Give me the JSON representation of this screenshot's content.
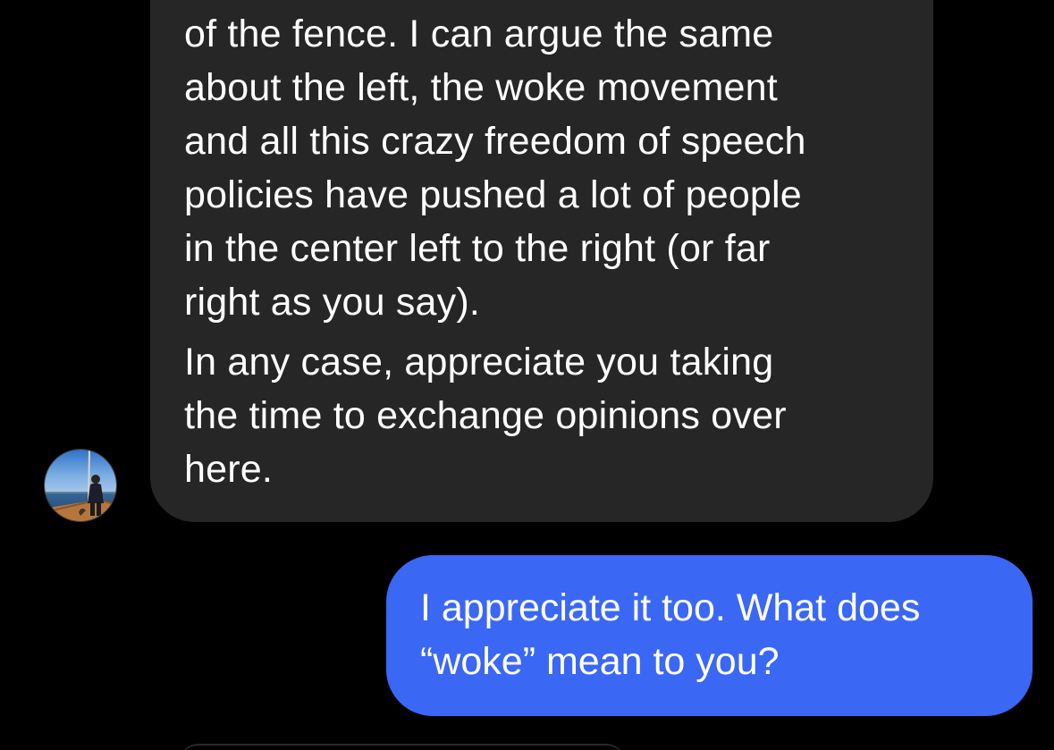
{
  "conversation": {
    "incoming": {
      "lines": [
        "of the fence. I can argue the same",
        "about the left, the woke movement",
        "and all this crazy freedom of speech",
        "policies have pushed a lot of people",
        "in the center left to the right (or far",
        "right as you say).",
        "In any case, appreciate you taking",
        "the time to exchange opinions over",
        "here."
      ],
      "avatar_icon": "profile-photo-person-on-boat",
      "bubble_color": "#262626"
    },
    "outgoing": {
      "lines": [
        "I appreciate it too. What does",
        "“woke” mean to you?"
      ],
      "bubble_color": "#3b67f5"
    }
  }
}
